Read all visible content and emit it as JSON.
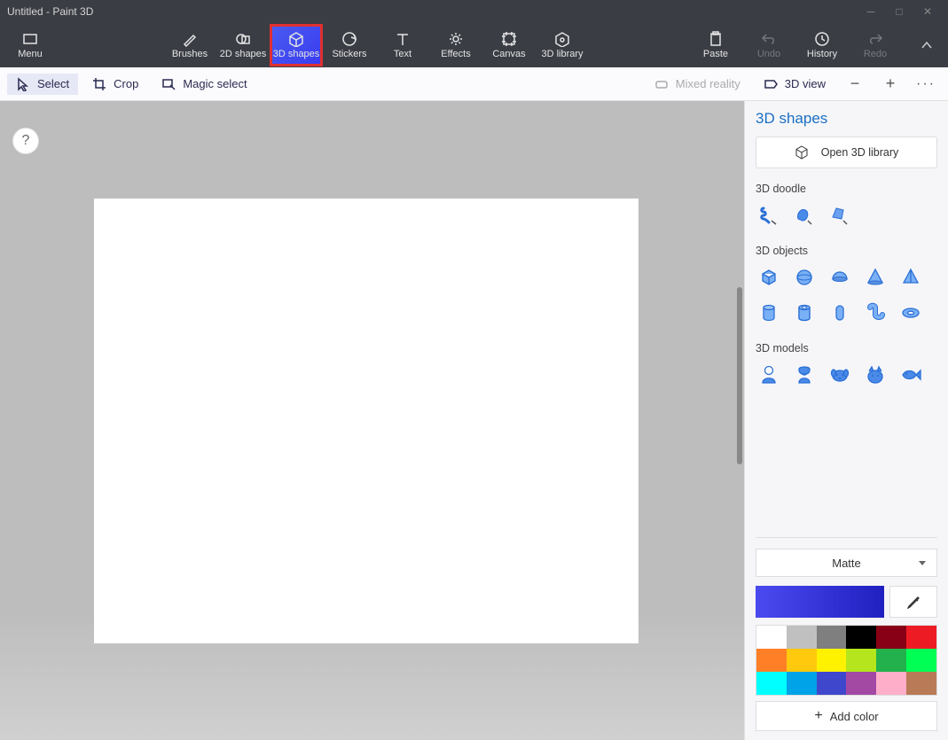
{
  "window": {
    "title": "Untitled - Paint 3D"
  },
  "toolbar": {
    "menu": "Menu",
    "brushes": "Brushes",
    "shapes2d": "2D shapes",
    "shapes3d": "3D shapes",
    "stickers": "Stickers",
    "text": "Text",
    "effects": "Effects",
    "canvas": "Canvas",
    "library3d": "3D library",
    "paste": "Paste",
    "undo": "Undo",
    "history": "History",
    "redo": "Redo"
  },
  "secondary": {
    "select": "Select",
    "crop": "Crop",
    "magic": "Magic select",
    "mixed": "Mixed reality",
    "view3d": "3D view"
  },
  "help": {
    "label": "?"
  },
  "panel": {
    "title": "3D shapes",
    "open_library": "Open 3D library",
    "sections": {
      "doodle": "3D doodle",
      "objects": "3D objects",
      "models": "3D models"
    },
    "material": "Matte",
    "add_color": "Add color",
    "palette": [
      "#ffffff",
      "#c0c0c0",
      "#7f7f7f",
      "#000000",
      "#880015",
      "#ed1c24",
      "#ff7f27",
      "#ffc90e",
      "#fff200",
      "#b5e61d",
      "#22b14c",
      "#00ff55",
      "#00ffff",
      "#00a2e8",
      "#3f48cc",
      "#a349a4",
      "#ffaec9",
      "#b97a57"
    ]
  }
}
